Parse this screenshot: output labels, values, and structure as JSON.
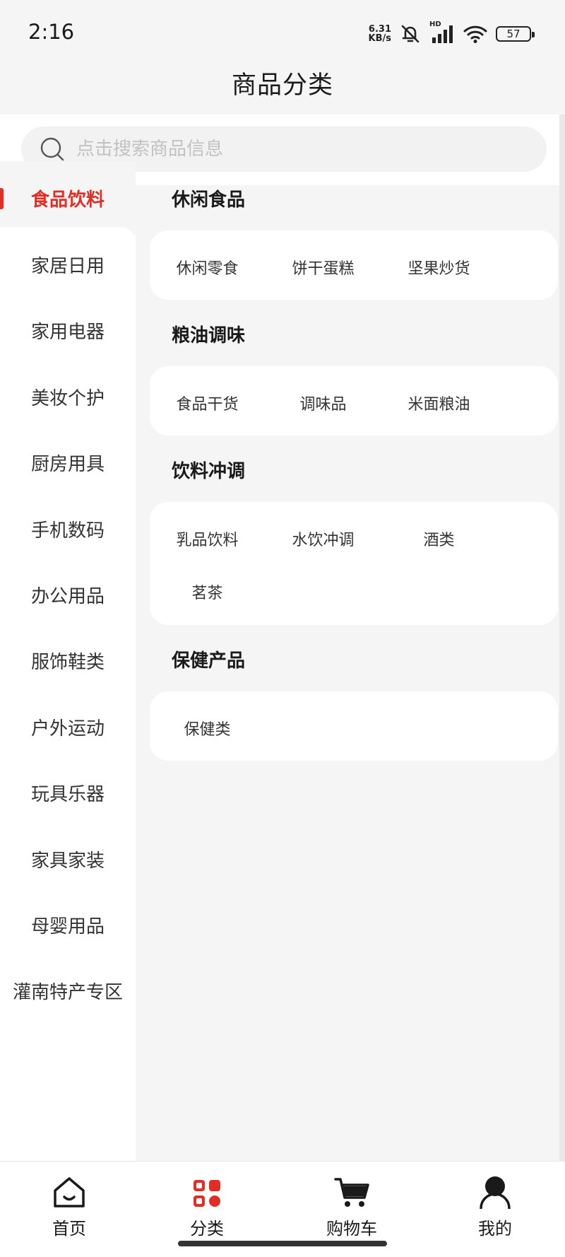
{
  "status_bar": {
    "time": "2:16",
    "net_speed_value": "6.31",
    "net_speed_unit": "KB/s",
    "signal_label": "HD",
    "battery": "57"
  },
  "header": {
    "title": "商品分类"
  },
  "search": {
    "placeholder": "点击搜索商品信息",
    "value": ""
  },
  "sidebar": {
    "active_index": 0,
    "items": [
      {
        "label": "食品饮料"
      },
      {
        "label": "家居日用"
      },
      {
        "label": "家用电器"
      },
      {
        "label": "美妆个护"
      },
      {
        "label": "厨房用具"
      },
      {
        "label": "手机数码"
      },
      {
        "label": "办公用品"
      },
      {
        "label": "服饰鞋类"
      },
      {
        "label": "户外运动"
      },
      {
        "label": "玩具乐器"
      },
      {
        "label": "家具家装"
      },
      {
        "label": "母婴用品"
      },
      {
        "label": "灌南特产专区"
      }
    ]
  },
  "content": {
    "sections": [
      {
        "title": "休闲食品",
        "items": [
          "休闲零食",
          "饼干蛋糕",
          "坚果炒货"
        ]
      },
      {
        "title": "粮油调味",
        "items": [
          "食品干货",
          "调味品",
          "米面粮油"
        ]
      },
      {
        "title": "饮料冲调",
        "items": [
          "乳品饮料",
          "水饮冲调",
          "酒类",
          "茗茶"
        ]
      },
      {
        "title": "保健产品",
        "items": [
          "保健类"
        ]
      }
    ]
  },
  "tabbar": {
    "active_index": 1,
    "active_color": "#e02e24",
    "items": [
      {
        "label": "首页",
        "icon": "home-icon"
      },
      {
        "label": "分类",
        "icon": "category-icon"
      },
      {
        "label": "购物车",
        "icon": "cart-icon"
      },
      {
        "label": "我的",
        "icon": "user-icon"
      }
    ]
  }
}
